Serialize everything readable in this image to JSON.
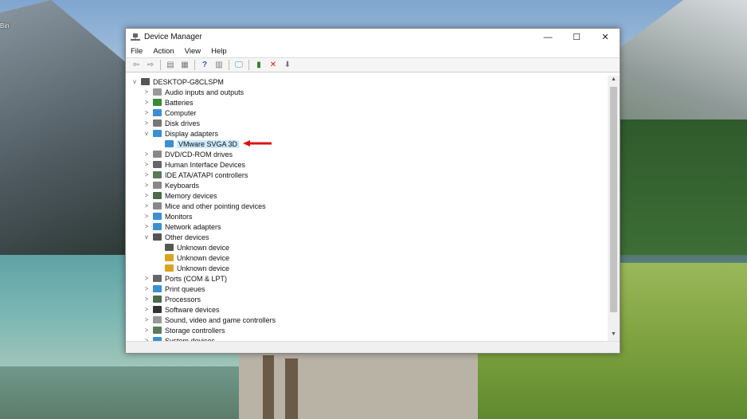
{
  "desktop": {
    "recycle_bin_label": "Bin"
  },
  "window": {
    "title": "Device Manager",
    "minimize": "—",
    "maximize": "☐",
    "close": "✕"
  },
  "menu": [
    "File",
    "Action",
    "View",
    "Help"
  ],
  "toolbar": [
    {
      "icon": "back-arrow-icon",
      "glyph": "⇦"
    },
    {
      "icon": "forward-arrow-icon",
      "glyph": "⇨"
    },
    {
      "icon": "properties-pane-icon",
      "glyph": "▤"
    },
    {
      "icon": "properties-icon",
      "glyph": "▦"
    },
    {
      "icon": "help-icon",
      "glyph": "?"
    },
    {
      "icon": "action-pane-icon",
      "glyph": "▥"
    },
    {
      "icon": "scan-hardware-monitor-icon",
      "glyph": "🖵"
    },
    {
      "icon": "update-driver-icon",
      "glyph": "▮"
    },
    {
      "icon": "uninstall-icon",
      "glyph": "✕"
    },
    {
      "icon": "disable-device-icon",
      "glyph": "⬇"
    }
  ],
  "tree": [
    {
      "label": "DESKTOP-G8CLSPM",
      "depth": 0,
      "expander": "v",
      "color": "#555"
    },
    {
      "label": "Audio inputs and outputs",
      "depth": 1,
      "expander": ">",
      "color": "#999"
    },
    {
      "label": "Batteries",
      "depth": 1,
      "expander": ">",
      "color": "#3a8a3a"
    },
    {
      "label": "Computer",
      "depth": 1,
      "expander": ">",
      "color": "#3a8fd0"
    },
    {
      "label": "Disk drives",
      "depth": 1,
      "expander": ">",
      "color": "#777"
    },
    {
      "label": "Display adapters",
      "depth": 1,
      "expander": "v",
      "color": "#3a8fd0"
    },
    {
      "label": "VMware SVGA 3D",
      "depth": 2,
      "expander": "",
      "color": "#3a8fd0",
      "selected": true
    },
    {
      "label": "DVD/CD-ROM drives",
      "depth": 1,
      "expander": ">",
      "color": "#888"
    },
    {
      "label": "Human Interface Devices",
      "depth": 1,
      "expander": ">",
      "color": "#666"
    },
    {
      "label": "IDE ATA/ATAPI controllers",
      "depth": 1,
      "expander": ">",
      "color": "#5a7a5a"
    },
    {
      "label": "Keyboards",
      "depth": 1,
      "expander": ">",
      "color": "#888"
    },
    {
      "label": "Memory devices",
      "depth": 1,
      "expander": ">",
      "color": "#4a6a4a"
    },
    {
      "label": "Mice and other pointing devices",
      "depth": 1,
      "expander": ">",
      "color": "#888"
    },
    {
      "label": "Monitors",
      "depth": 1,
      "expander": ">",
      "color": "#3a8fd0"
    },
    {
      "label": "Network adapters",
      "depth": 1,
      "expander": ">",
      "color": "#3a8fd0"
    },
    {
      "label": "Other devices",
      "depth": 1,
      "expander": "v",
      "color": "#555"
    },
    {
      "label": "Unknown device",
      "depth": 2,
      "expander": "",
      "color": "#555"
    },
    {
      "label": "Unknown device",
      "depth": 2,
      "expander": "",
      "color": "#d9a520"
    },
    {
      "label": "Unknown device",
      "depth": 2,
      "expander": "",
      "color": "#d9a520"
    },
    {
      "label": "Ports (COM & LPT)",
      "depth": 1,
      "expander": ">",
      "color": "#666"
    },
    {
      "label": "Print queues",
      "depth": 1,
      "expander": ">",
      "color": "#3a8fd0"
    },
    {
      "label": "Processors",
      "depth": 1,
      "expander": ">",
      "color": "#4a6a4a"
    },
    {
      "label": "Software devices",
      "depth": 1,
      "expander": ">",
      "color": "#333"
    },
    {
      "label": "Sound, video and game controllers",
      "depth": 1,
      "expander": ">",
      "color": "#999"
    },
    {
      "label": "Storage controllers",
      "depth": 1,
      "expander": ">",
      "color": "#5a7a5a"
    },
    {
      "label": "System devices",
      "depth": 1,
      "expander": ">",
      "color": "#3a8fd0"
    }
  ],
  "annotation_arrow_color": "#e01010"
}
